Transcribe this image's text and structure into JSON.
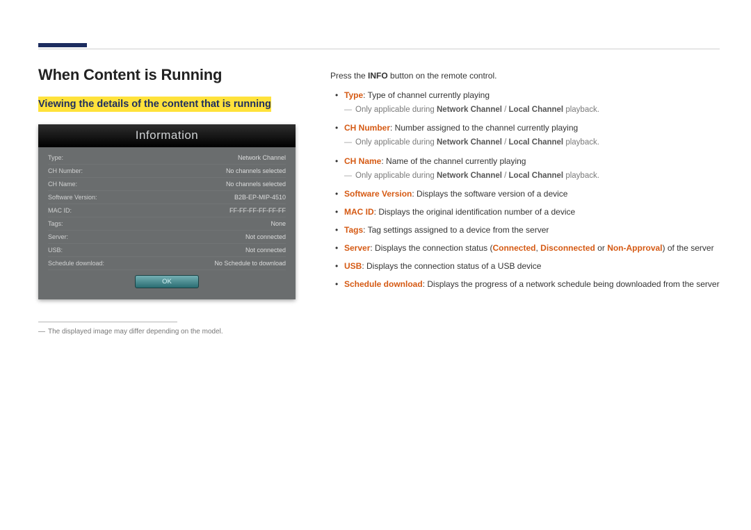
{
  "heading": "When Content is Running",
  "subheading": "Viewing the details of the content that is running",
  "panel": {
    "title": "Information",
    "rows": [
      {
        "label": "Type:",
        "value": "Network Channel"
      },
      {
        "label": "CH Number:",
        "value": "No channels selected"
      },
      {
        "label": "CH Name:",
        "value": "No channels selected"
      },
      {
        "label": "Software Version:",
        "value": "B2B-EP-MIP-4510"
      },
      {
        "label": "MAC ID:",
        "value": "FF-FF-FF-FF-FF-FF"
      },
      {
        "label": "Tags:",
        "value": "None"
      },
      {
        "label": "Server:",
        "value": "Not connected"
      },
      {
        "label": "USB:",
        "value": "Not connected"
      },
      {
        "label": "Schedule download:",
        "value": "No Schedule to download"
      }
    ],
    "ok": "OK"
  },
  "footnote_dash": "―",
  "footnote": "The displayed image may differ depending on the model.",
  "lead_pre": "Press the ",
  "lead_bold": "INFO",
  "lead_post": " button on the remote control.",
  "items": {
    "type_key": "Type",
    "type_text": ": Type of channel currently playing",
    "sub_pre": "Only applicable during ",
    "sub_nc": "Network Channel",
    "sub_sep": " / ",
    "sub_lc": "Local Channel",
    "sub_post": " playback.",
    "chnum_key": "CH Number",
    "chnum_text": ": Number assigned to the channel currently playing",
    "chname_key": "CH Name",
    "chname_text": ": Name of the channel currently playing",
    "swver_key": "Software Version",
    "swver_text": ": Displays the software version of a device",
    "mac_key": "MAC ID",
    "mac_text": ": Displays the original identification number of a device",
    "tags_key": "Tags",
    "tags_text": ": Tag settings assigned to a device from the server",
    "server_key": "Server",
    "server_pre": ": Displays the connection status (",
    "server_connected": "Connected",
    "server_comma": ", ",
    "server_disconnected": "Disconnected",
    "server_or": " or ",
    "server_nonapp": "Non-Approval",
    "server_post": ") of the server",
    "usb_key": "USB",
    "usb_text": ": Displays the connection status of a USB device",
    "sched_key": "Schedule download",
    "sched_text": ": Displays the progress of a network schedule being downloaded from the server"
  }
}
